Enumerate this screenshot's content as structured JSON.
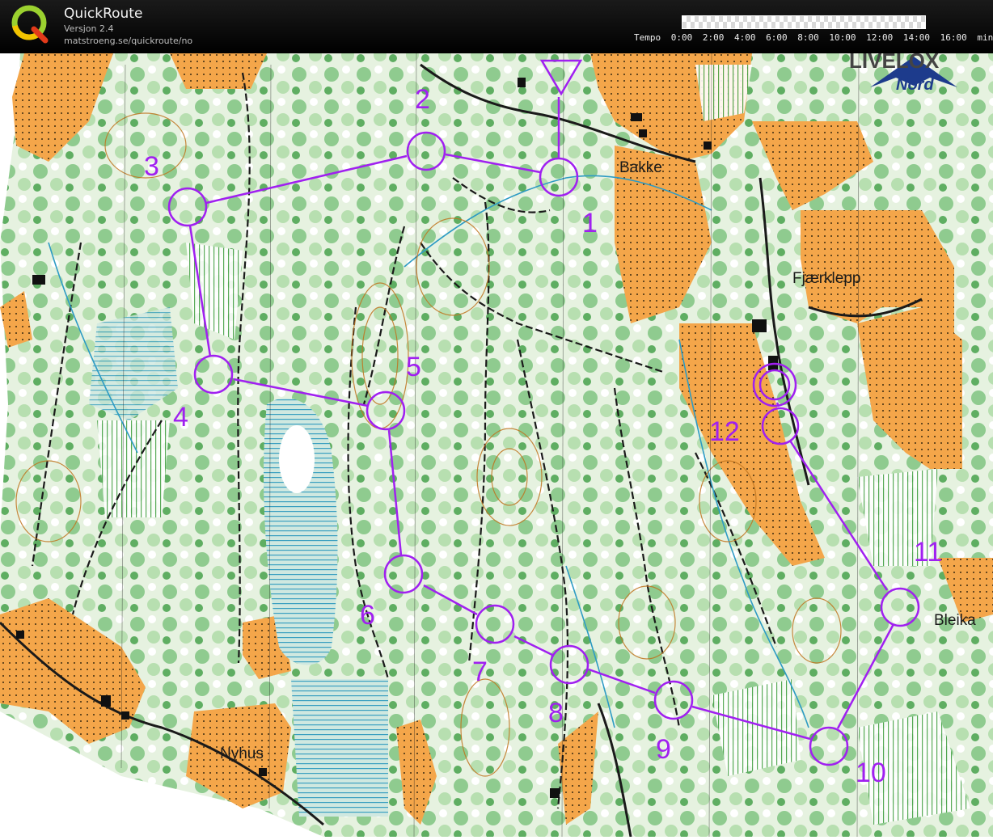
{
  "app": {
    "title": "QuickRoute",
    "version": "Versjon 2.4",
    "url": "matstroeng.se/quickroute/no",
    "logo_icon": "quickroute-q-logo-icon"
  },
  "tempo": {
    "label": "Tempo",
    "ticks": [
      "0:00",
      "2:00",
      "4:00",
      "6:00",
      "8:00",
      "10:00",
      "12:00",
      "14:00",
      "16:00"
    ],
    "unit": "min/km"
  },
  "brand": {
    "name": "LIVELOX",
    "sub": "Nord"
  },
  "colors": {
    "course": "#a020f0",
    "open_land": "#f4a64a",
    "forest_green": "#7bbf7b",
    "water_blue": "#3aa6c9",
    "contour_brown": "#b5651d"
  },
  "places": {
    "bakke": "Bakke",
    "fjaerklepp": "Fjærklepp",
    "bleika": "Bleika",
    "nyhus": "Nyhus"
  },
  "course": {
    "start_icon": "start-triangle-icon",
    "finish_icon": "finish-double-circle-icon",
    "controls": [
      "1",
      "2",
      "3",
      "4",
      "5",
      "6",
      "7",
      "8",
      "9",
      "10",
      "11",
      "12"
    ]
  }
}
